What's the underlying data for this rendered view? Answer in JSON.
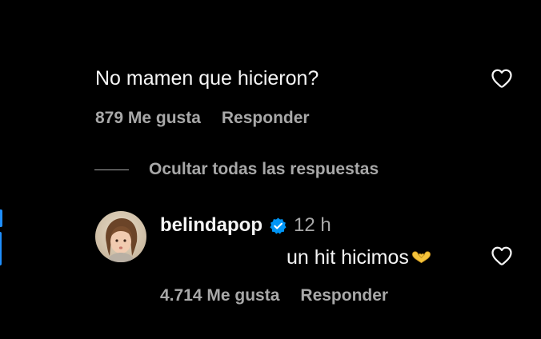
{
  "comment": {
    "text": "No mamen que hicieron?",
    "likes": "879 Me gusta",
    "reply_label": "Responder"
  },
  "replies_toggle": {
    "label": "Ocultar todas las respuestas"
  },
  "reply": {
    "username": "belindapop",
    "verified": true,
    "time": "12 h",
    "text": "un hit hicimos",
    "emoji": "heart-hands-emoji",
    "likes": "4.714 Me gusta",
    "reply_label": "Responder"
  },
  "colors": {
    "background": "#000000",
    "primary_text": "#f5f5f5",
    "secondary_text": "#a8a8a8",
    "verified_badge": "#0095f6",
    "emoji": "#f5c33b"
  },
  "icons": {
    "like": "heart-outline-icon",
    "verified": "verified-badge-icon"
  }
}
